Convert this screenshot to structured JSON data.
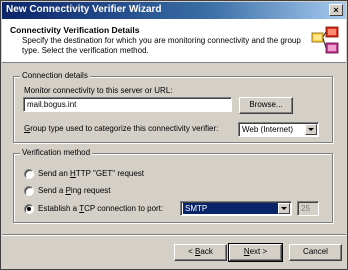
{
  "window": {
    "title": "New Connectivity Verifier Wizard",
    "close_glyph": "×"
  },
  "header": {
    "title": "Connectivity Verification Details",
    "description": "Specify the destination for which you are monitoring connectivity and the group type. Select the verification method."
  },
  "connection": {
    "legend": "Connection details",
    "monitor_label": "Monitor connectivity to this server or URL:",
    "server_value": "mail.bogus.int",
    "browse_label": "Browse...",
    "group_label_pre": "",
    "group_label_u": "G",
    "group_label_post": "roup type used to categorize this connectivity verifier:",
    "group_value": "Web (Internet)"
  },
  "verification": {
    "legend": "Verification method",
    "options": [
      {
        "pre": "Send an ",
        "u": "H",
        "post": "TTP \"GET\" request",
        "checked": false
      },
      {
        "pre": "Send a ",
        "u": "P",
        "post": "ing request",
        "checked": false
      },
      {
        "pre": "Establish a ",
        "u": "T",
        "post": "CP connection to port:",
        "checked": true
      }
    ],
    "protocol_value": "SMTP",
    "port_value": "25"
  },
  "footer": {
    "back_pre": "< ",
    "back_u": "B",
    "back_post": "ack",
    "next_u": "N",
    "next_post": "ext >",
    "cancel_label": "Cancel"
  }
}
